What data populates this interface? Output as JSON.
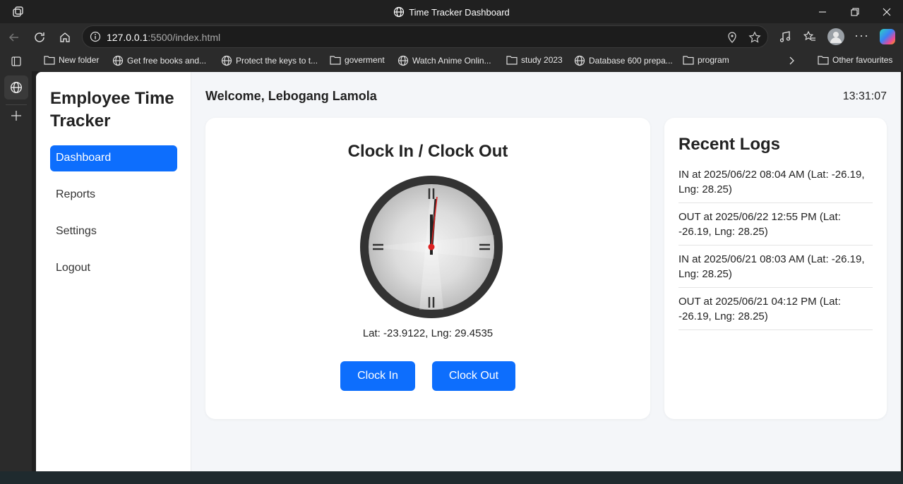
{
  "window": {
    "title": "Time Tracker Dashboard"
  },
  "browser": {
    "url_host": "127.0.0.1",
    "url_rest": ":5500/index.html"
  },
  "bookmarks": [
    {
      "label": "New folder",
      "icon": "folder-icon"
    },
    {
      "label": "Get free books and...",
      "icon": "globe-icon"
    },
    {
      "label": "Protect the keys to t...",
      "icon": "globe-icon"
    },
    {
      "label": "goverment",
      "icon": "folder-icon"
    },
    {
      "label": "Watch Anime Onlin...",
      "icon": "globe-icon"
    },
    {
      "label": "study 2023",
      "icon": "folder-icon"
    },
    {
      "label": "Database 600 prepa...",
      "icon": "globe-icon"
    },
    {
      "label": "program",
      "icon": "folder-icon"
    }
  ],
  "other_favourites": "Other favourites",
  "sidebar": {
    "title": "Employee Time Tracker",
    "items": [
      {
        "label": "Dashboard",
        "active": true
      },
      {
        "label": "Reports",
        "active": false
      },
      {
        "label": "Settings",
        "active": false
      },
      {
        "label": "Logout",
        "active": false
      }
    ]
  },
  "header": {
    "welcome": "Welcome, Lebogang Lamola",
    "time": "13:31:07"
  },
  "clock_card": {
    "title": "Clock In / Clock Out",
    "coords": "Lat: -23.9122, Lng: 29.4535",
    "clock_in_label": "Clock In",
    "clock_out_label": "Clock Out"
  },
  "logs_card": {
    "title": "Recent Logs",
    "items": [
      "IN at 2025/06/22 08:04 AM (Lat: -26.19, Lng: 28.25)",
      "OUT at 2025/06/22 12:55 PM (Lat: -26.19, Lng: 28.25)",
      "IN at 2025/06/21 08:03 AM (Lat: -26.19, Lng: 28.25)",
      "OUT at 2025/06/21 04:12 PM (Lat: -26.19, Lng: 28.25)"
    ]
  },
  "colors": {
    "accent": "#0d6efd",
    "page_bg": "#f4f6f9"
  }
}
